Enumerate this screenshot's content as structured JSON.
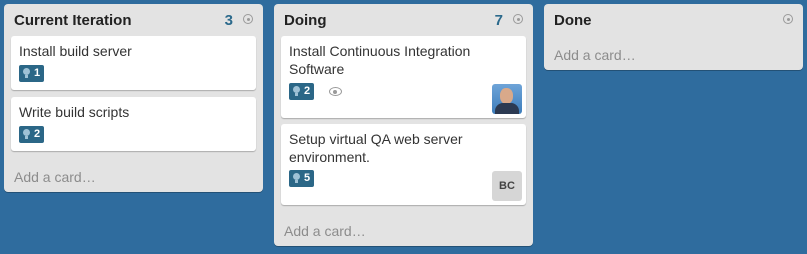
{
  "lists": [
    {
      "title": "Current Iteration",
      "count": "3",
      "add_card": "Add a card…",
      "cards": [
        {
          "title": "Install build server",
          "badge": "1"
        },
        {
          "title": "Write build scripts",
          "badge": "2"
        }
      ]
    },
    {
      "title": "Doing",
      "count": "7",
      "add_card": "Add a card…",
      "cards": [
        {
          "title": "Install Continuous Integration Software",
          "badge": "2",
          "watch_icon": "eye-icon",
          "member": "avatar-photo"
        },
        {
          "title": "Setup virtual QA web server environment.",
          "badge": "5",
          "member_initials": "BC"
        }
      ]
    },
    {
      "title": "Done",
      "count": "",
      "add_card": "Add a card…",
      "cards": []
    }
  ],
  "colors": {
    "board_background": "#2f6c9e",
    "list_background": "#e3e3e3",
    "badge_background": "#2b6787",
    "count_color": "#2c6a8c"
  }
}
